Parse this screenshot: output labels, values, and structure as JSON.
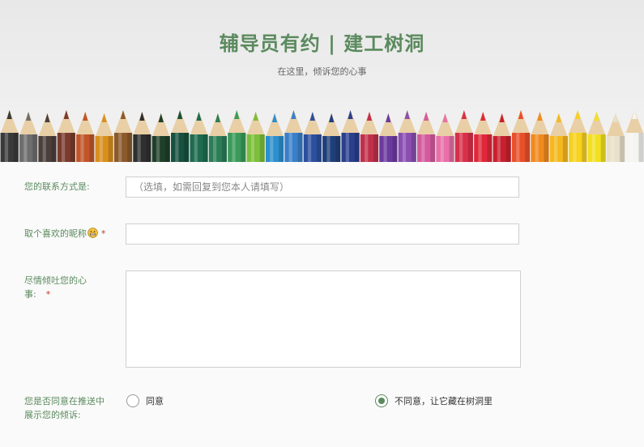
{
  "header": {
    "title": "辅导员有约 | 建工树洞",
    "subtitle": "在这里，倾诉您的心事"
  },
  "pencil_colors": [
    "#3a3a3a",
    "#6e6e6e",
    "#4a3f3a",
    "#7a3b2e",
    "#c0562a",
    "#d98f1e",
    "#8b5a2b",
    "#2f2f2f",
    "#1f3f2a",
    "#16503e",
    "#1e6b4f",
    "#2a7d56",
    "#3a9a5a",
    "#7bbf3a",
    "#2c8fce",
    "#3a7fc8",
    "#2c4f9e",
    "#1f3f7a",
    "#2a3f8e",
    "#c0304a",
    "#6a3a9e",
    "#8a4fb0",
    "#d45a9e",
    "#e86fa8",
    "#d82f4a",
    "#e0283a",
    "#c8202e",
    "#e8502a",
    "#f08a1e",
    "#f5b81e",
    "#f7d21e",
    "#f2e020",
    "#e8e0c8",
    "#f4f4f0"
  ],
  "form": {
    "contact": {
      "label": "您的联系方式是:",
      "placeholder": "（选填，如需回复到您本人请填写）",
      "value": ""
    },
    "nickname": {
      "label": "取个喜欢的昵称",
      "required_mark": "*",
      "value": ""
    },
    "story": {
      "label_line1": "尽情倾吐您的心",
      "label_line2": "事:",
      "required_mark": "*",
      "value": ""
    },
    "consent": {
      "label_line1": "您是否同意在推送中",
      "label_line2": "展示您的倾诉:",
      "options": [
        {
          "label": "同意",
          "checked": false
        },
        {
          "label": "不同意，让它藏在树洞里",
          "checked": true
        }
      ]
    }
  },
  "colors": {
    "accent_green": "#5b8a5e",
    "required_red": "#c0392b"
  }
}
